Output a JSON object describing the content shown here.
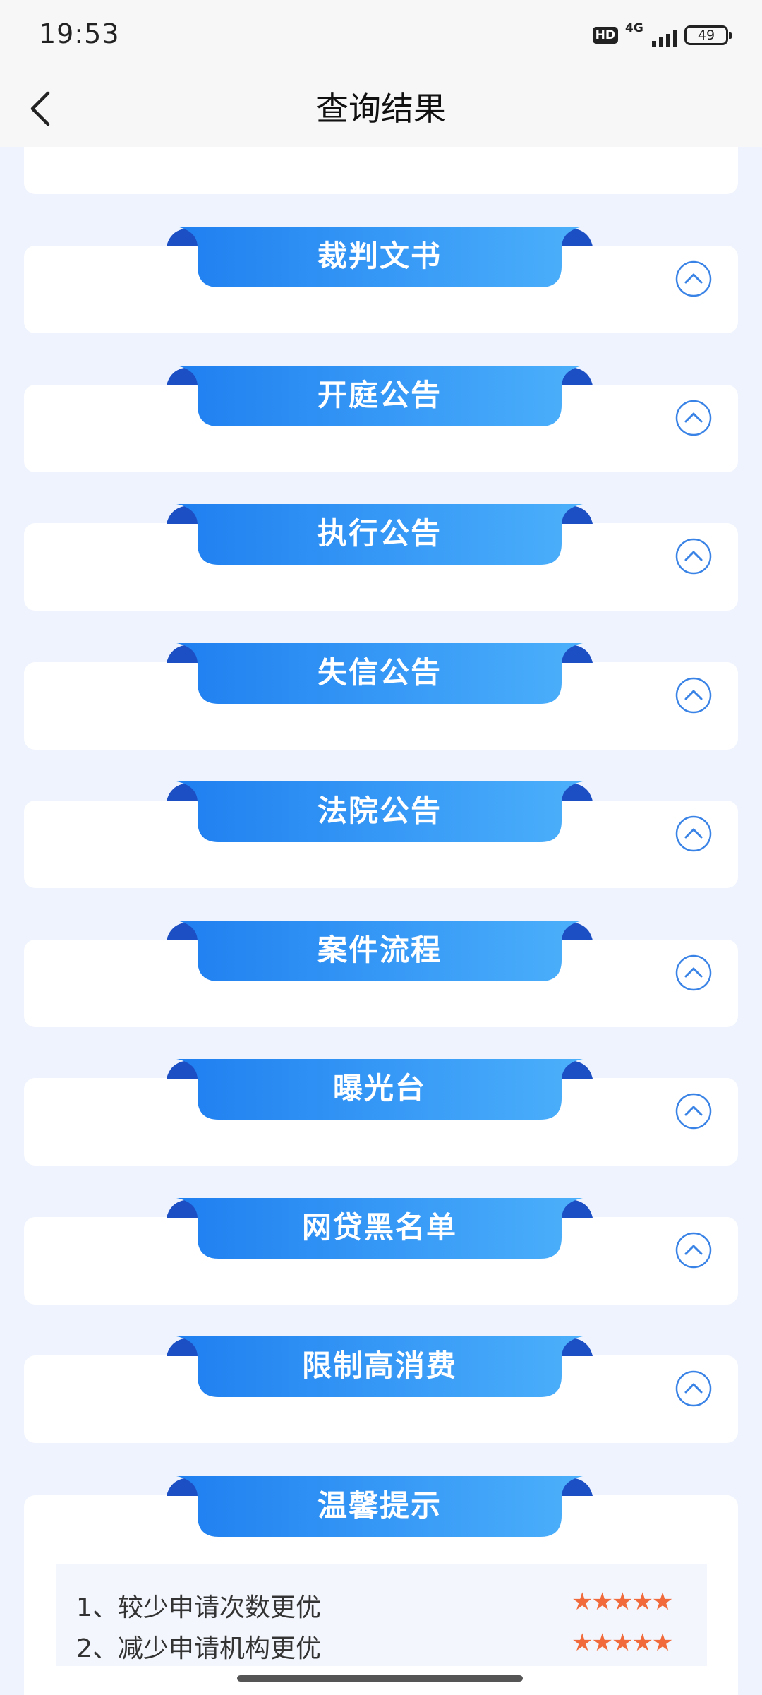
{
  "status_bar": {
    "time": "19:53",
    "network": "4G",
    "hd": "HD",
    "battery": "49"
  },
  "header": {
    "title": "查询结果"
  },
  "sections": [
    {
      "title": "裁判文书",
      "icon": "chevron-up-icon"
    },
    {
      "title": "开庭公告",
      "icon": "chevron-up-icon"
    },
    {
      "title": "执行公告",
      "icon": "chevron-up-icon"
    },
    {
      "title": "失信公告",
      "icon": "chevron-up-icon"
    },
    {
      "title": "法院公告",
      "icon": "chevron-up-icon"
    },
    {
      "title": "案件流程",
      "icon": "chevron-up-icon"
    },
    {
      "title": "曝光台",
      "icon": "chevron-up-icon"
    },
    {
      "title": "网贷黑名单",
      "icon": "chevron-up-icon"
    },
    {
      "title": "限制高消费",
      "icon": "chevron-up-icon"
    }
  ],
  "tips": {
    "title": "温馨提示",
    "items": [
      {
        "text": "1、较少申请次数更优",
        "stars": "★★★★★"
      },
      {
        "text": "2、减少申请机构更优",
        "stars": "★★★★★"
      }
    ]
  },
  "colors": {
    "ribbon_start": "#1f7ff0",
    "ribbon_end": "#4cb0fb",
    "ribbon_fold": "#1d4fc4",
    "accent": "#3a83e6",
    "star": "#f06a3b"
  }
}
